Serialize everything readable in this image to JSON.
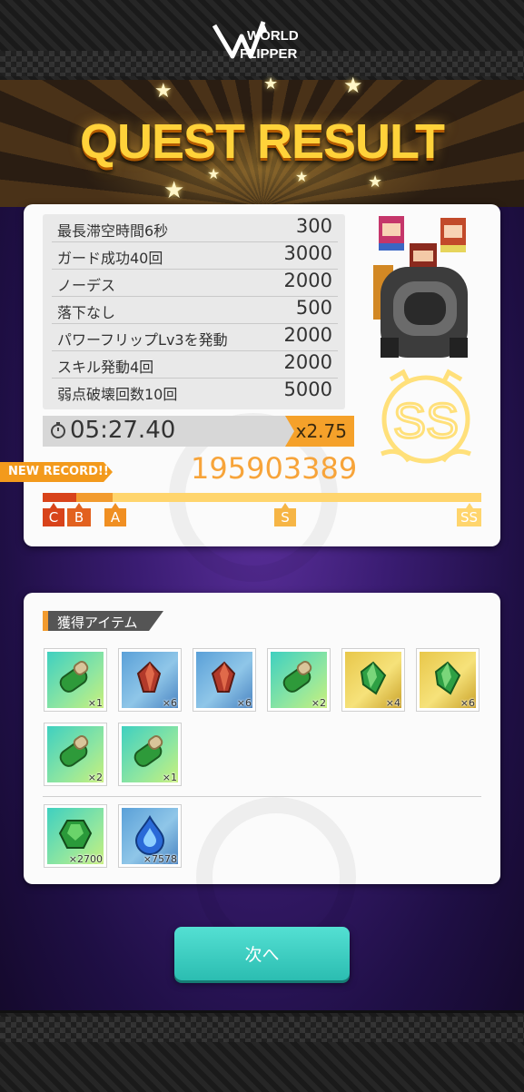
{
  "header": {
    "logo_text_1": "WORLD",
    "logo_text_2": "FLIPPER"
  },
  "banner": {
    "title": "QUEST RESULT"
  },
  "result": {
    "bonuses": [
      {
        "label": "最長滞空時間6秒",
        "value": "300"
      },
      {
        "label": "ガード成功40回",
        "value": "3000"
      },
      {
        "label": "ノーデス",
        "value": "2000"
      },
      {
        "label": "落下なし",
        "value": "500"
      },
      {
        "label": "パワーフリップLv3を発動",
        "value": "2000"
      },
      {
        "label": "スキル発動4回",
        "value": "2000"
      },
      {
        "label": "弱点破壊回数10回",
        "value": "5000"
      }
    ],
    "time": "05:27.40",
    "multiplier": "x2.75",
    "new_record": "NEW RECORD!!",
    "score": "195903389",
    "rank": "SS",
    "gauge_ranks": [
      "C",
      "B",
      "A",
      "S",
      "SS"
    ],
    "gauge_fill_percent": 16
  },
  "items": {
    "section_title": "獲得アイテム",
    "materials": [
      {
        "icon": "green-scroll-icon",
        "bg": "teal",
        "qty": "×1"
      },
      {
        "icon": "red-crystal-icon",
        "bg": "blue",
        "qty": "×6"
      },
      {
        "icon": "red-crystal-icon",
        "bg": "blue",
        "qty": "×6"
      },
      {
        "icon": "green-scroll-icon",
        "bg": "teal",
        "qty": "×2"
      },
      {
        "icon": "green-crystal-icon",
        "bg": "gold",
        "qty": "×4"
      },
      {
        "icon": "green-crystal-icon",
        "bg": "gold",
        "qty": "×6"
      },
      {
        "icon": "green-scroll-icon",
        "bg": "teal",
        "qty": "×2"
      },
      {
        "icon": "green-scroll-icon",
        "bg": "teal",
        "qty": "×1"
      }
    ],
    "currency": [
      {
        "icon": "green-gem-icon",
        "bg": "teal",
        "qty": "×2700"
      },
      {
        "icon": "blue-drop-icon",
        "bg": "blue",
        "qty": "×7578"
      }
    ]
  },
  "next_button": {
    "label": "次へ"
  },
  "colors": {
    "accent": "#f29b2e",
    "button": "#3cc9bd",
    "gold": "#ffd23a",
    "score": "#f7a43a"
  }
}
